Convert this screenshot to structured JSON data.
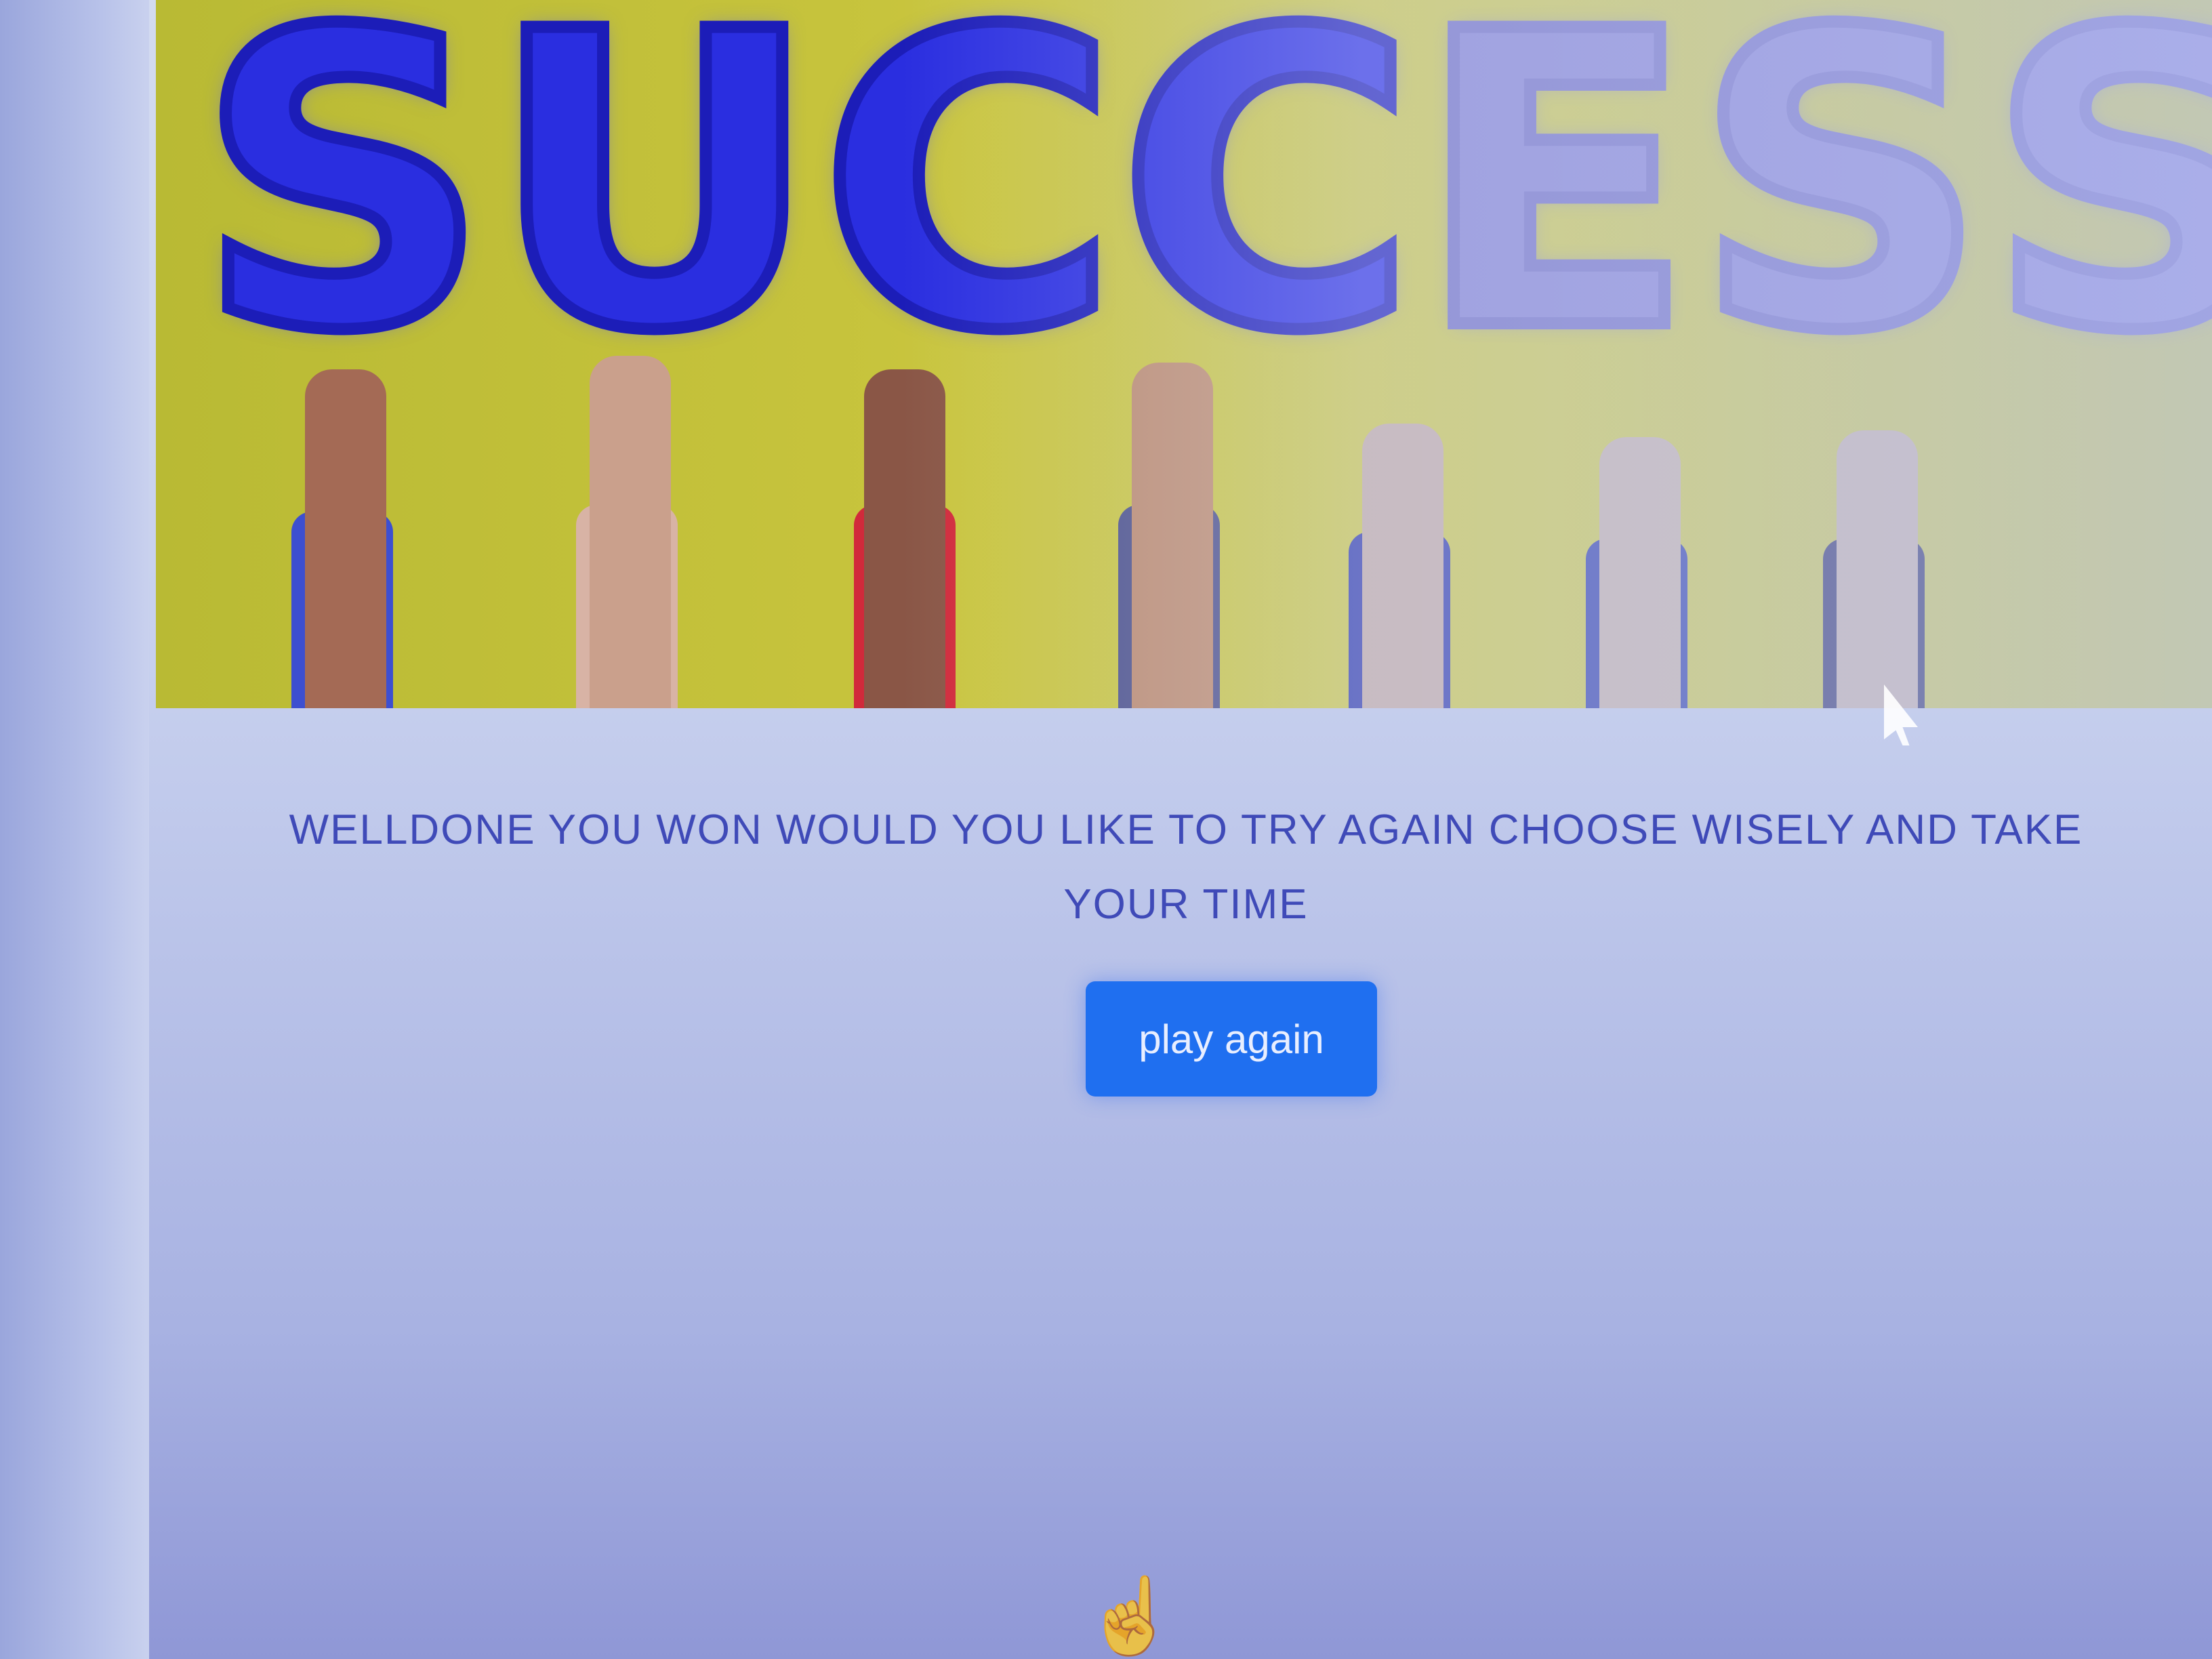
{
  "hero": {
    "letters": [
      "S",
      "U",
      "C",
      "C",
      "E",
      "S",
      "S"
    ],
    "alt": "success-balloons-banner"
  },
  "message": {
    "text": "WELLDONE YOU WON WOULD YOU LIKE TO TRY AGAIN CHOOSE WISELY AND TAKE YOUR TIME"
  },
  "actions": {
    "play_again_label": "play again"
  },
  "icons": {
    "cursor": "hand-cursor-icon",
    "pointer": "arrow-pointer-icon"
  },
  "colors": {
    "button": "#1f6ff0",
    "text": "#3f4ab8",
    "balloon": "#2a2ee0",
    "banner_bg": "#c9c53e"
  }
}
